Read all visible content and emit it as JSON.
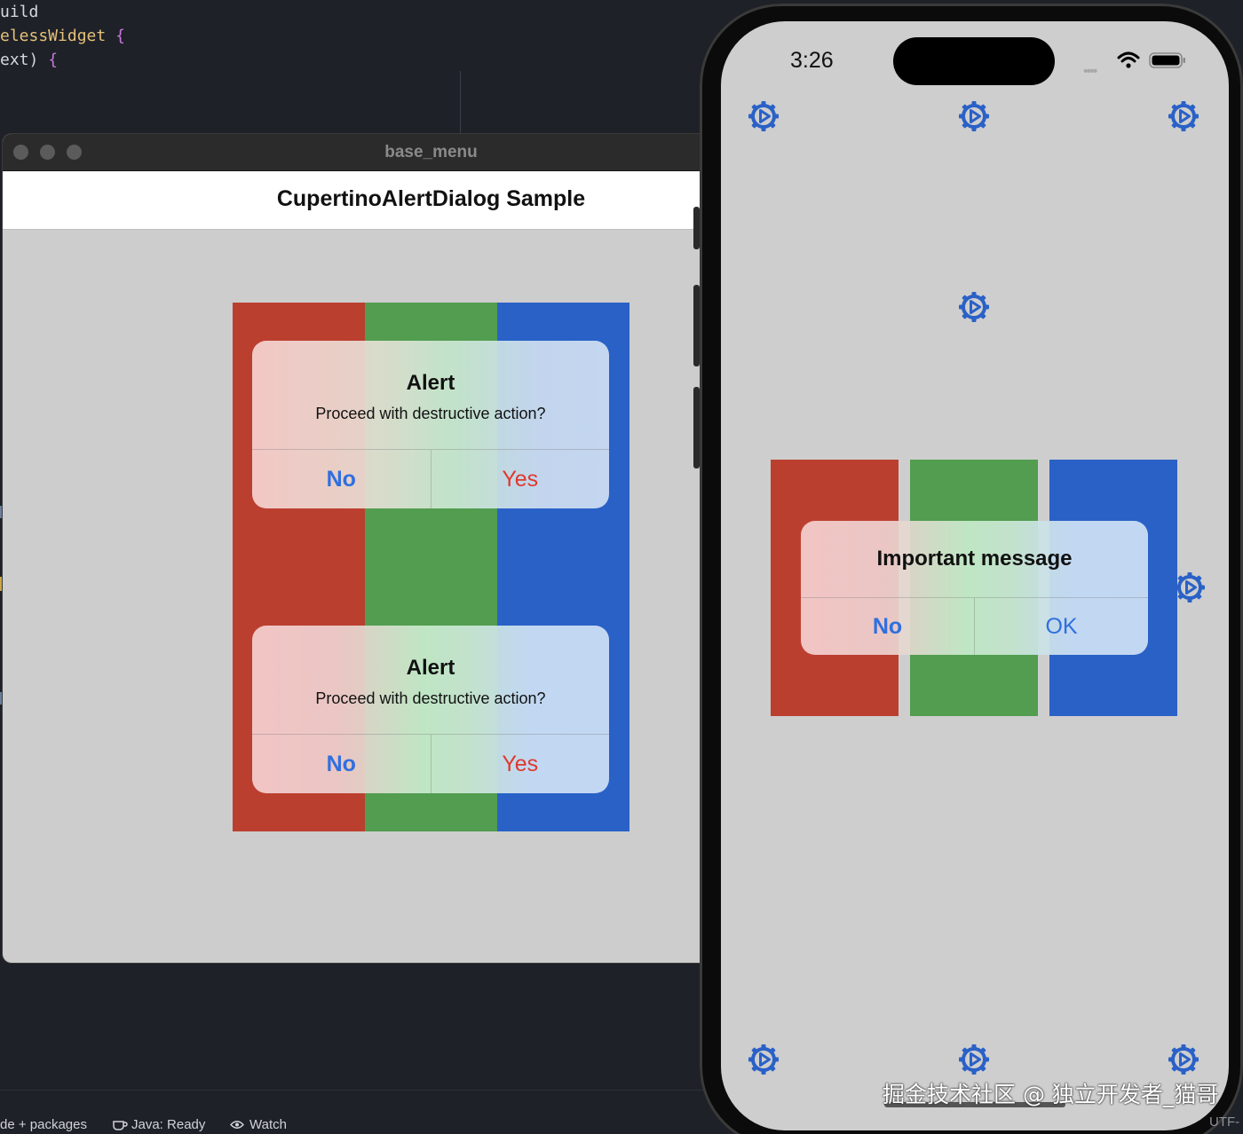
{
  "editor": {
    "line1": "uild",
    "line2_cls": "elessWidget",
    "line2_brace": "{",
    "line3_a": "ext)",
    "line3_brace": "{"
  },
  "statusbar": {
    "packages": "de + packages",
    "java": "Java: Ready",
    "watch": "Watch",
    "encoding": "UTF-"
  },
  "desktop_window": {
    "title": "base_menu",
    "appbar_title": "CupertinoAlertDialog Sample",
    "dialogs": [
      {
        "title": "Alert",
        "message": "Proceed with destructive action?",
        "no_label": "No",
        "yes_label": "Yes"
      },
      {
        "title": "Alert",
        "message": "Proceed with destructive action?",
        "no_label": "No",
        "yes_label": "Yes"
      }
    ]
  },
  "phone": {
    "time": "3:26",
    "signal_dots": "••••",
    "dialog": {
      "title": "Important message",
      "no_label": "No",
      "ok_label": "OK"
    }
  },
  "watermark": "掘金技术社区 @ 独立开发者_猫哥",
  "colors": {
    "stripe_red": "#bb3f2f",
    "stripe_green": "#529d50",
    "stripe_blue": "#2a61c7",
    "action_blue": "#2f6fe0",
    "destructive_red": "#e0382e",
    "gear_blue": "#2a61c7"
  },
  "icons": {
    "gear": "settings-gear-play-icon",
    "wifi": "wifi-icon",
    "battery": "battery-icon"
  }
}
